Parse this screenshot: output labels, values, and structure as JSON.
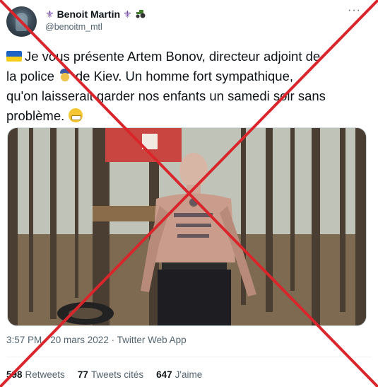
{
  "author": {
    "name": "Benoit Martin",
    "handle": "@benoitm_mtl",
    "name_emoji_icons": [
      "fleur-de-lis-icon",
      "fleur-de-lis-icon",
      "tractor-icon"
    ]
  },
  "tweet": {
    "lines": [
      "Je vous présente Artem Bonov, directeur adjoint de",
      "la police",
      "de Kiev. Un homme fort sympathique,",
      "qu'on laisserait garder nos enfants un samedi soir sans",
      "problème."
    ],
    "timestamp": "3:57 PM · 20 mars 2022 · Twitter Web App"
  },
  "stats": {
    "retweets_count": "598",
    "retweets_label": "Retweets",
    "quotes_count": "77",
    "quotes_label": "Tweets cités",
    "likes_count": "647",
    "likes_label": "J'aime"
  },
  "colors": {
    "cross": "#d9262c",
    "ua_blue": "#1e63c6",
    "ua_yellow": "#f6cf1c",
    "secondary_text": "#536471"
  }
}
